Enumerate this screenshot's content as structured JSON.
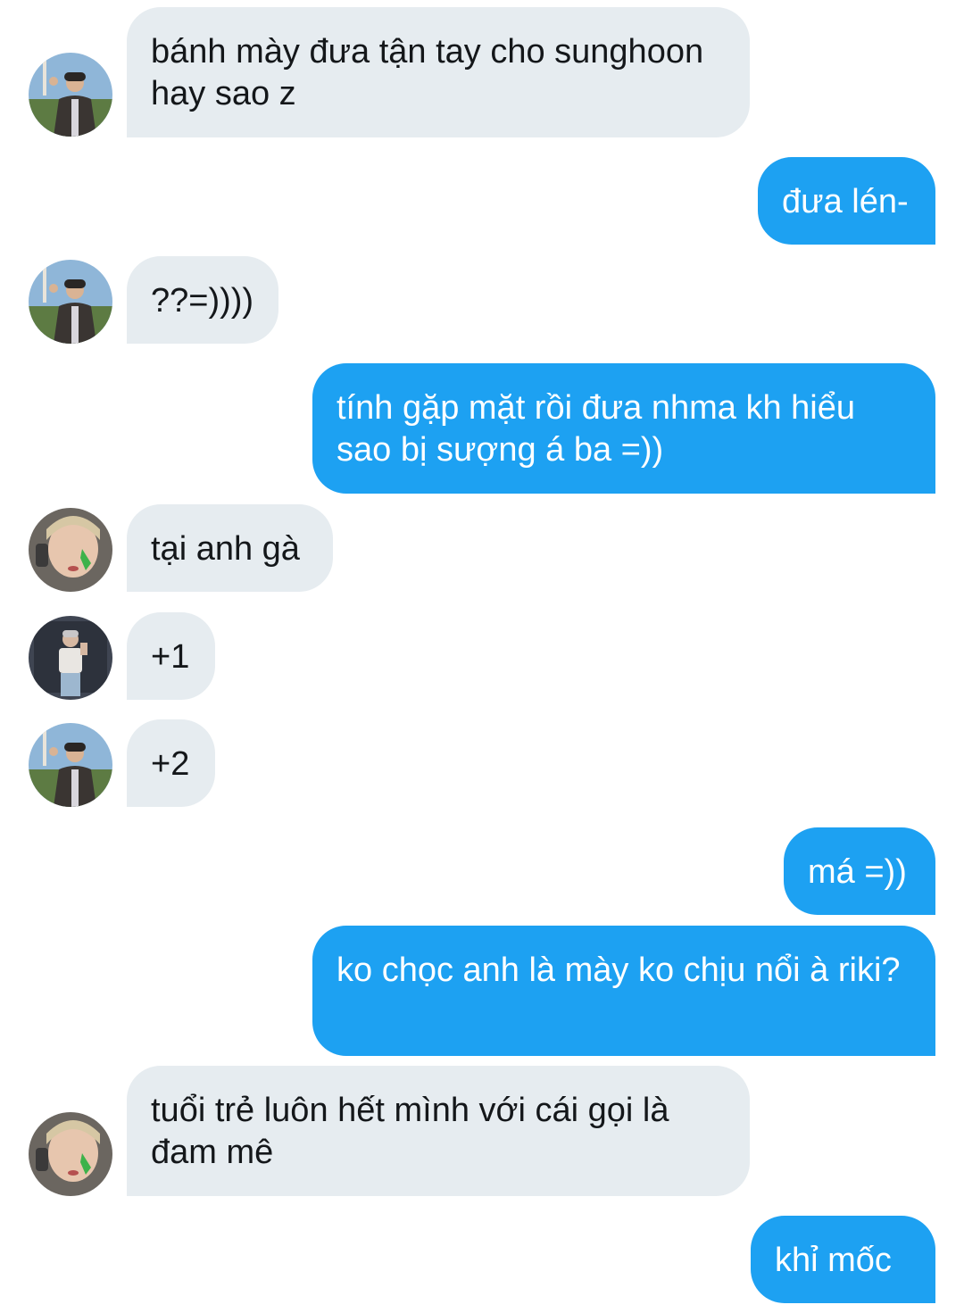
{
  "colors": {
    "incoming_bubble": "#e6ecf0",
    "outgoing_bubble": "#1da1f2",
    "incoming_text": "#14171a",
    "outgoing_text": "#ffffff",
    "background": "#ffffff"
  },
  "messages": [
    {
      "direction": "incoming",
      "sender_avatar": "avatar-a",
      "text": "bánh mày đưa tận tay cho sunghoon hay sao z"
    },
    {
      "direction": "outgoing",
      "text": "đưa lén-"
    },
    {
      "direction": "incoming",
      "sender_avatar": "avatar-a",
      "text": "??=))))"
    },
    {
      "direction": "outgoing",
      "text": "tính gặp mặt rồi đưa nhma kh hiểu sao bị sượng á ba =))"
    },
    {
      "direction": "incoming",
      "sender_avatar": "avatar-b",
      "text": "tại anh gà"
    },
    {
      "direction": "incoming",
      "sender_avatar": "avatar-c",
      "text": "+1"
    },
    {
      "direction": "incoming",
      "sender_avatar": "avatar-a",
      "text": "+2"
    },
    {
      "direction": "outgoing",
      "text": "má =))"
    },
    {
      "direction": "outgoing",
      "text": "ko chọc anh là mày ko chịu nổi à riki?"
    },
    {
      "direction": "incoming",
      "sender_avatar": "avatar-b",
      "text": "tuổi trẻ luôn hết mình với cái gọi là đam mê"
    },
    {
      "direction": "outgoing",
      "text": "khỉ mốc"
    }
  ]
}
